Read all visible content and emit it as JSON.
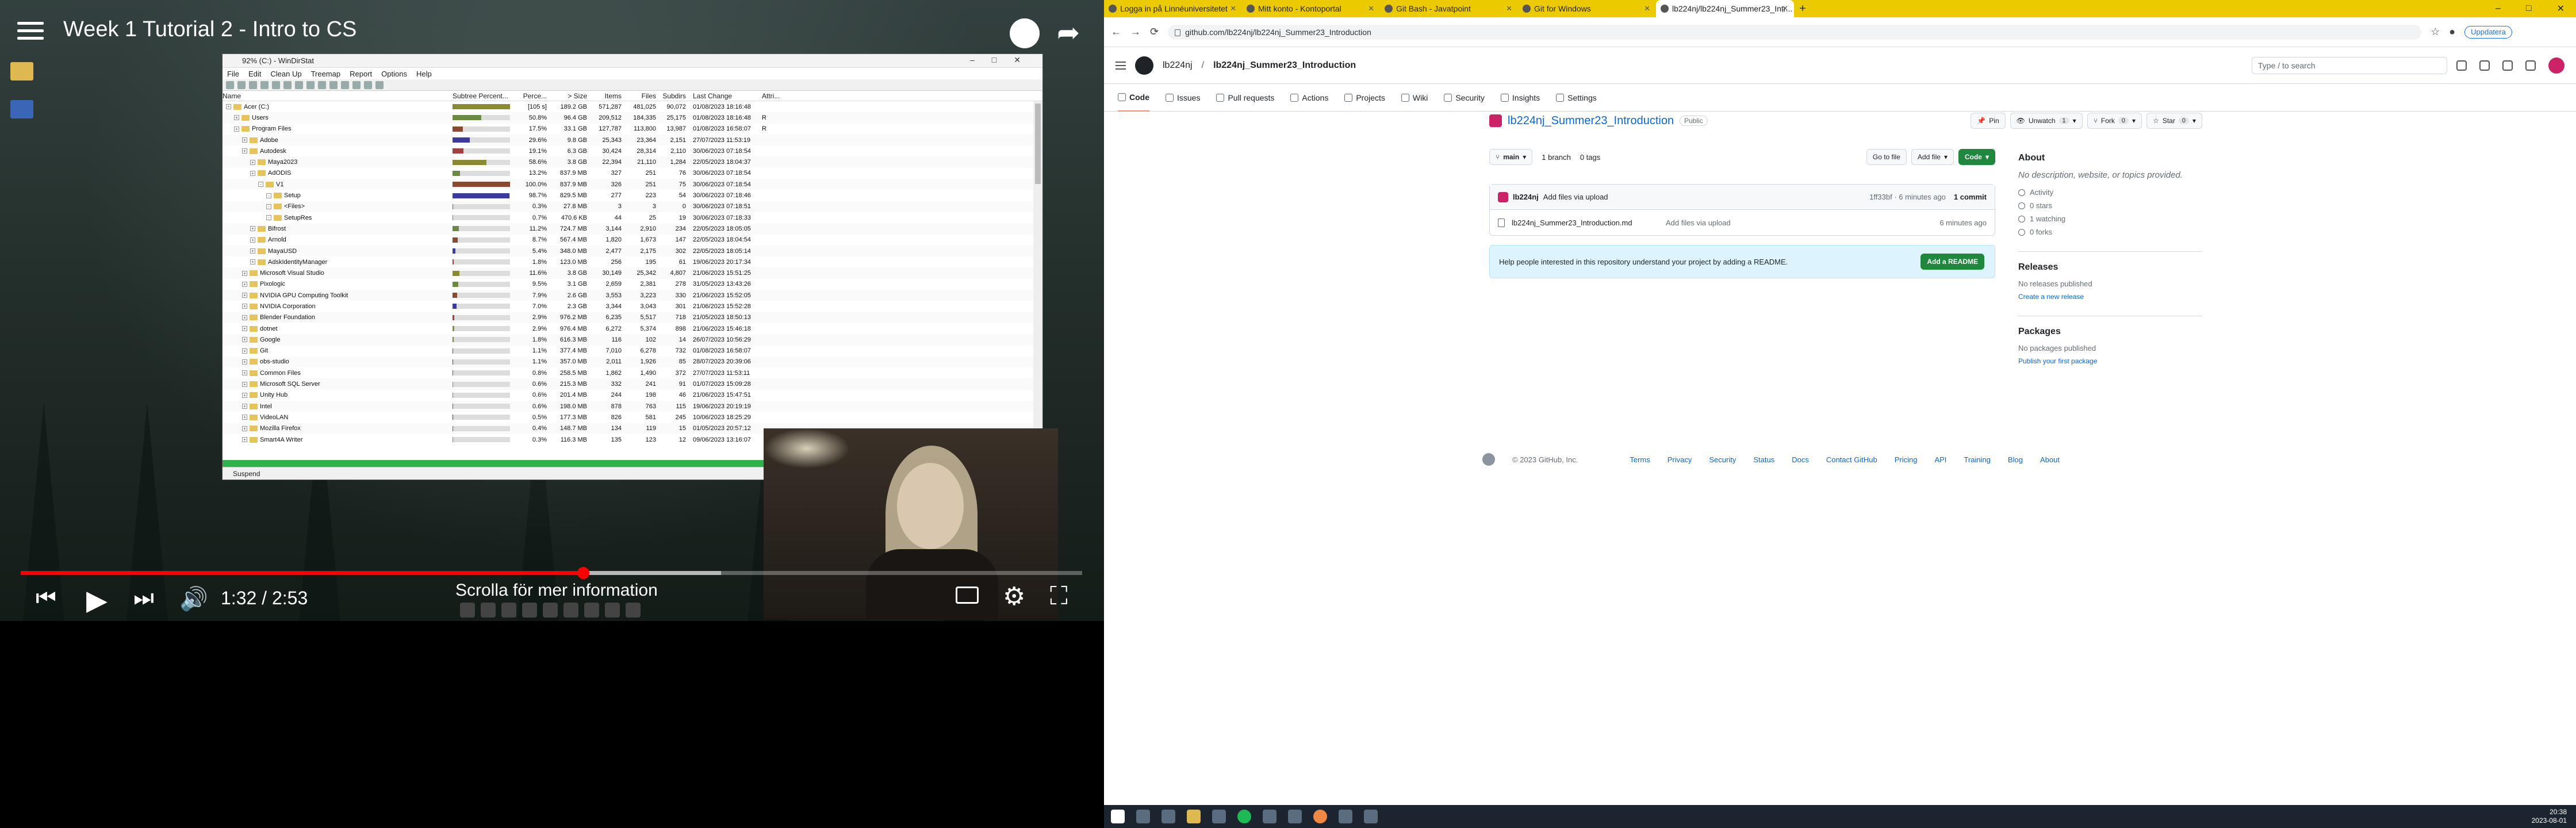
{
  "video": {
    "title": "Week 1 Tutorial 2 - Intro to CS",
    "time": "1:32 / 2:53",
    "chapter": "Scrolla för mer information",
    "progress_played": 0.53,
    "progress_buffered": 0.66
  },
  "windirstat": {
    "title": "92% (C:) - WinDirStat",
    "menu": [
      "File",
      "Edit",
      "Clean Up",
      "Treemap",
      "Report",
      "Options",
      "Help"
    ],
    "headers": [
      "Name",
      "Subtree Percent...",
      "Perce...",
      "> Size",
      "Items",
      "Files",
      "Subdirs",
      "Last Change",
      "Attri..."
    ],
    "status": "Suspend",
    "rows": [
      {
        "name": "Acer (C:)",
        "pct": "[105 s]",
        "size": "189.2 GB",
        "items": "571,287",
        "files": "481,025",
        "subs": "90,072",
        "date": "01/08/2023 18:16:48",
        "attr": "",
        "fill": 1.0,
        "indent": 0
      },
      {
        "name": "Users",
        "pct": "50.8%",
        "size": "96.4 GB",
        "items": "209,512",
        "files": "184,335",
        "subs": "25,175",
        "date": "01/08/2023 18:16:48",
        "attr": "R",
        "fill": 0.5,
        "indent": 1
      },
      {
        "name": "Program Files",
        "pct": "17.5%",
        "size": "33.1 GB",
        "items": "127,787",
        "files": "113,800",
        "subs": "13,987",
        "date": "01/08/2023 16:58:07",
        "attr": "R",
        "fill": 0.18,
        "indent": 1
      },
      {
        "name": "Adobe",
        "pct": "29.6%",
        "size": "9.8 GB",
        "items": "25,343",
        "files": "23,364",
        "subs": "2,151",
        "date": "27/07/2023 11:53:19",
        "attr": "",
        "fill": 0.3,
        "indent": 2
      },
      {
        "name": "Autodesk",
        "pct": "19.1%",
        "size": "6.3 GB",
        "items": "30,424",
        "files": "28,314",
        "subs": "2,110",
        "date": "30/06/2023 07:18:54",
        "attr": "",
        "fill": 0.19,
        "indent": 2
      },
      {
        "name": "Maya2023",
        "pct": "58.6%",
        "size": "3.8 GB",
        "items": "22,394",
        "files": "21,110",
        "subs": "1,284",
        "date": "22/05/2023 18:04:37",
        "attr": "",
        "fill": 0.59,
        "indent": 3
      },
      {
        "name": "AdODIS",
        "pct": "13.2%",
        "size": "837.9 MB",
        "items": "327",
        "files": "251",
        "subs": "76",
        "date": "30/06/2023 07:18:54",
        "attr": "",
        "fill": 0.13,
        "indent": 3
      },
      {
        "name": "V1",
        "pct": "100.0%",
        "size": "837.9 MB",
        "items": "326",
        "files": "251",
        "subs": "75",
        "date": "30/06/2023 07:18:54",
        "attr": "",
        "fill": 1.0,
        "indent": 4
      },
      {
        "name": "Setup",
        "pct": "98.7%",
        "size": "829.5 MB",
        "items": "277",
        "files": "223",
        "subs": "54",
        "date": "30/06/2023 07:18:46",
        "attr": "",
        "fill": 0.99,
        "indent": 5
      },
      {
        "name": "<Files>",
        "pct": "0.3%",
        "size": "27.8 MB",
        "items": "3",
        "files": "3",
        "subs": "0",
        "date": "30/06/2023 07:18:51",
        "attr": "",
        "fill": 0.01,
        "indent": 5
      },
      {
        "name": "SetupRes",
        "pct": "0.7%",
        "size": "470.6 KB",
        "items": "44",
        "files": "25",
        "subs": "19",
        "date": "30/06/2023 07:18:33",
        "attr": "",
        "fill": 0.01,
        "indent": 5
      },
      {
        "name": "Bifrost",
        "pct": "11.2%",
        "size": "724.7 MB",
        "items": "3,144",
        "files": "2,910",
        "subs": "234",
        "date": "22/05/2023 18:05:05",
        "attr": "",
        "fill": 0.11,
        "indent": 3
      },
      {
        "name": "Arnold",
        "pct": "8.7%",
        "size": "567.4 MB",
        "items": "1,820",
        "files": "1,673",
        "subs": "147",
        "date": "22/05/2023 18:04:54",
        "attr": "",
        "fill": 0.09,
        "indent": 3
      },
      {
        "name": "MayaUSD",
        "pct": "5.4%",
        "size": "348.0 MB",
        "items": "2,477",
        "files": "2,175",
        "subs": "302",
        "date": "22/05/2023 18:05:14",
        "attr": "",
        "fill": 0.05,
        "indent": 3
      },
      {
        "name": "AdskIdentityManager",
        "pct": "1.8%",
        "size": "123.0 MB",
        "items": "256",
        "files": "195",
        "subs": "61",
        "date": "19/06/2023 20:17:34",
        "attr": "",
        "fill": 0.02,
        "indent": 3
      },
      {
        "name": "Microsoft Visual Studio",
        "pct": "11.6%",
        "size": "3.8 GB",
        "items": "30,149",
        "files": "25,342",
        "subs": "4,807",
        "date": "21/06/2023 15:51:25",
        "attr": "",
        "fill": 0.12,
        "indent": 2
      },
      {
        "name": "Pixologic",
        "pct": "9.5%",
        "size": "3.1 GB",
        "items": "2,659",
        "files": "2,381",
        "subs": "278",
        "date": "31/05/2023 13:43:26",
        "attr": "",
        "fill": 0.1,
        "indent": 2
      },
      {
        "name": "NVIDIA GPU Computing Toolkit",
        "pct": "7.9%",
        "size": "2.6 GB",
        "items": "3,553",
        "files": "3,223",
        "subs": "330",
        "date": "21/06/2023 15:52:05",
        "attr": "",
        "fill": 0.08,
        "indent": 2
      },
      {
        "name": "NVIDIA Corporation",
        "pct": "7.0%",
        "size": "2.3 GB",
        "items": "3,344",
        "files": "3,043",
        "subs": "301",
        "date": "21/06/2023 15:52:28",
        "attr": "",
        "fill": 0.07,
        "indent": 2
      },
      {
        "name": "Blender Foundation",
        "pct": "2.9%",
        "size": "976.2 MB",
        "items": "6,235",
        "files": "5,517",
        "subs": "718",
        "date": "21/05/2023 18:50:13",
        "attr": "",
        "fill": 0.03,
        "indent": 2
      },
      {
        "name": "dotnet",
        "pct": "2.9%",
        "size": "976.4 MB",
        "items": "6,272",
        "files": "5,374",
        "subs": "898",
        "date": "21/06/2023 15:46:18",
        "attr": "",
        "fill": 0.03,
        "indent": 2
      },
      {
        "name": "Google",
        "pct": "1.8%",
        "size": "616.3 MB",
        "items": "116",
        "files": "102",
        "subs": "14",
        "date": "26/07/2023 10:56:29",
        "attr": "",
        "fill": 0.02,
        "indent": 2
      },
      {
        "name": "Git",
        "pct": "1.1%",
        "size": "377.4 MB",
        "items": "7,010",
        "files": "6,278",
        "subs": "732",
        "date": "01/08/2023 16:58:07",
        "attr": "",
        "fill": 0.01,
        "indent": 2
      },
      {
        "name": "obs-studio",
        "pct": "1.1%",
        "size": "357.0 MB",
        "items": "2,011",
        "files": "1,926",
        "subs": "85",
        "date": "28/07/2023 20:39:06",
        "attr": "",
        "fill": 0.01,
        "indent": 2
      },
      {
        "name": "Common Files",
        "pct": "0.8%",
        "size": "258.5 MB",
        "items": "1,862",
        "files": "1,490",
        "subs": "372",
        "date": "27/07/2023 11:53:11",
        "attr": "",
        "fill": 0.01,
        "indent": 2
      },
      {
        "name": "Microsoft SQL Server",
        "pct": "0.6%",
        "size": "215.3 MB",
        "items": "332",
        "files": "241",
        "subs": "91",
        "date": "01/07/2023 15:09:28",
        "attr": "",
        "fill": 0.01,
        "indent": 2
      },
      {
        "name": "Unity Hub",
        "pct": "0.6%",
        "size": "201.4 MB",
        "items": "244",
        "files": "198",
        "subs": "46",
        "date": "21/06/2023 15:47:51",
        "attr": "",
        "fill": 0.01,
        "indent": 2
      },
      {
        "name": "Intel",
        "pct": "0.6%",
        "size": "198.0 MB",
        "items": "878",
        "files": "763",
        "subs": "115",
        "date": "19/06/2023 20:19:19",
        "attr": "",
        "fill": 0.01,
        "indent": 2
      },
      {
        "name": "VideoLAN",
        "pct": "0.5%",
        "size": "177.3 MB",
        "items": "826",
        "files": "581",
        "subs": "245",
        "date": "10/06/2023 18:25:29",
        "attr": "",
        "fill": 0.005,
        "indent": 2
      },
      {
        "name": "Mozilla Firefox",
        "pct": "0.4%",
        "size": "148.7 MB",
        "items": "134",
        "files": "119",
        "subs": "15",
        "date": "01/05/2023 20:57:12",
        "attr": "",
        "fill": 0.004,
        "indent": 2
      },
      {
        "name": "Smart4A Writer",
        "pct": "0.3%",
        "size": "116.3 MB",
        "items": "135",
        "files": "123",
        "subs": "12",
        "date": "09/06/2023 13:16:07",
        "attr": "",
        "fill": 0.003,
        "indent": 2
      }
    ]
  },
  "browser": {
    "tabs": [
      {
        "label": "Logga in på Linnéuniversitetet",
        "active": false
      },
      {
        "label": "Mitt konto - Kontoportal",
        "active": false
      },
      {
        "label": "Git Bash - Javatpoint",
        "active": false
      },
      {
        "label": "Git for Windows",
        "active": false
      },
      {
        "label": "lb224nj/lb224nj_Summer23_Intr...",
        "active": true
      }
    ],
    "new_tab": "+",
    "url": "github.com/lb224nj/lb224nj_Summer23_Introduction",
    "update_label": "Uppdatera"
  },
  "github": {
    "breadcrumb_user": "lb224nj",
    "breadcrumb_sep": "/",
    "breadcrumb_repo": "lb224nj_Summer23_Introduction",
    "search_placeholder": "Type / to search",
    "nav": [
      "Code",
      "Issues",
      "Pull requests",
      "Actions",
      "Projects",
      "Wiki",
      "Security",
      "Insights",
      "Settings"
    ],
    "repo_name": "lb224nj_Summer23_Introduction",
    "repo_visibility": "Public",
    "pin_label": "Pin",
    "unwatch_label": "Unwatch",
    "unwatch_count": "1",
    "fork_label": "Fork",
    "fork_count": "0",
    "star_label": "Star",
    "star_count": "0",
    "branch_name": "main",
    "branches": "1 branch",
    "tags": "0 tags",
    "goto_file": "Go to file",
    "add_file": "Add file",
    "code_btn": "Code",
    "commit_author": "lb224nj",
    "commit_msg": "Add files via upload",
    "commit_hash": "1ff33bf",
    "commit_time": "· 6 minutes ago",
    "commit_count": "1 commit",
    "files": [
      {
        "name": "lb224nj_Summer23_Introduction.md",
        "msg": "Add files via upload",
        "ago": "6 minutes ago"
      }
    ],
    "readme_prompt": "Help people interested in this repository understand your project by adding a README.",
    "add_readme": "Add a README",
    "about_title": "About",
    "about_desc": "No description, website, or topics provided.",
    "about_items": [
      "Activity",
      "0 stars",
      "1 watching",
      "0 forks"
    ],
    "releases_title": "Releases",
    "releases_none": "No releases published",
    "releases_link": "Create a new release",
    "packages_title": "Packages",
    "packages_none": "No packages published",
    "packages_link": "Publish your first package",
    "footer_copy": "© 2023 GitHub, Inc.",
    "footer_links": [
      "Terms",
      "Privacy",
      "Security",
      "Status",
      "Docs",
      "Contact GitHub",
      "Pricing",
      "API",
      "Training",
      "Blog",
      "About"
    ]
  },
  "taskbar": {
    "time": "20:38",
    "date": "2023-08-01"
  }
}
